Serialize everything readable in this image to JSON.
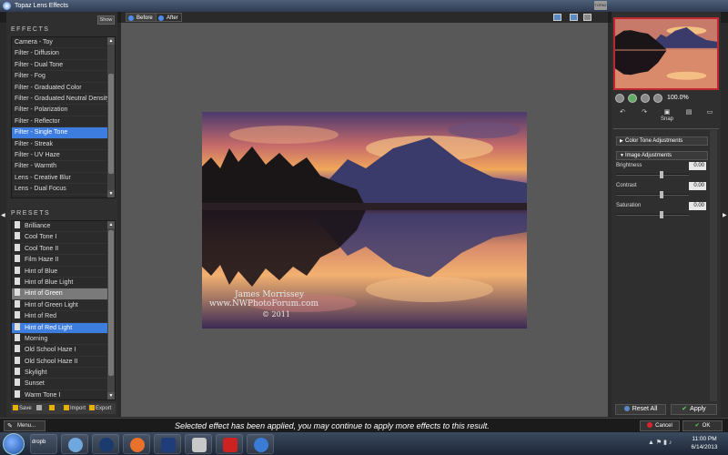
{
  "window": {
    "title": "Topaz Lens Effects"
  },
  "effects": {
    "section_label": "EFFECTS",
    "show_label": "Show",
    "items": [
      "Camera - Toy",
      "Filter - Diffusion",
      "Filter - Dual Tone",
      "Filter - Fog",
      "Filter - Graduated Color",
      "Filter - Graduated Neutral Density",
      "Filter - Polarization",
      "Filter - Reflector",
      "Filter - Single Tone",
      "Filter - Streak",
      "Filter - UV Haze",
      "Filter - Warmth",
      "Lens - Creative Blur",
      "Lens - Dual Focus"
    ],
    "selected": "Filter - Single Tone"
  },
  "presets": {
    "section_label": "PRESETS",
    "items": [
      "Brilliance",
      "Cool Tone I",
      "Cool Tone II",
      "Film Haze II",
      "Hint of Blue",
      "Hint of Blue Light",
      "Hint of Green",
      "Hint of Green Light",
      "Hint of Red",
      "Hint of Red Light",
      "Morning",
      "Old School Haze I",
      "Old School Haze II",
      "Skylight",
      "Sunset",
      "Warm Tone I"
    ],
    "selected": "Hint of Red Light",
    "hovered": "Hint of Green",
    "toolbar": {
      "save": "Save",
      "import": "Import",
      "export": "Export"
    }
  },
  "view_tabs": {
    "before": "Before",
    "after": "After"
  },
  "photo": {
    "watermark_name": "James Morrissey",
    "watermark_site": "www.NWPhotoForum.com",
    "watermark_year": "© 2011"
  },
  "navigator": {
    "zoom": "100.0%",
    "snap_label": "Snap"
  },
  "adjustments": {
    "color_tone_header": "Color Tone Adjustments",
    "image_header": "Image Adjustments",
    "sliders": [
      {
        "label": "Brightness",
        "value": "0.00"
      },
      {
        "label": "Contrast",
        "value": "0.00"
      },
      {
        "label": "Saturation",
        "value": "0.00"
      }
    ]
  },
  "buttons": {
    "reset_all": "Reset All",
    "apply": "Apply",
    "cancel": "Cancel",
    "ok": "OK",
    "menu": "Menu..."
  },
  "status": {
    "message": "Selected effect has been applied, you may continue to apply more effects to this result."
  },
  "taskbar": {
    "app_label": "dropb",
    "time": "11:00 PM",
    "date": "6/14/2013"
  }
}
